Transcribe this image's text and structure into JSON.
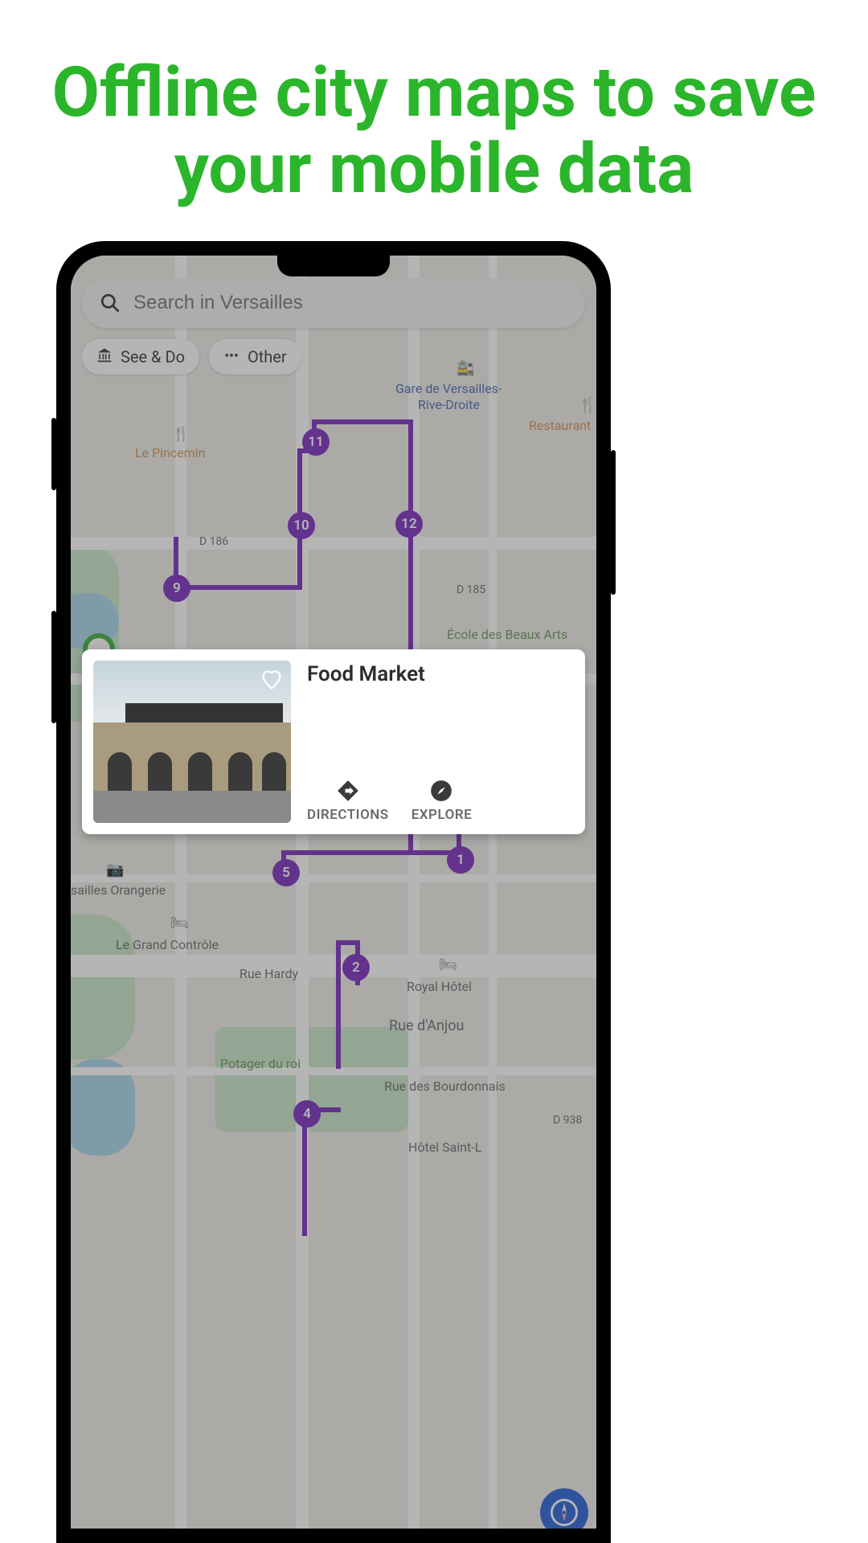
{
  "headline": "Offline city maps to save your mobile data",
  "search": {
    "placeholder": "Search in Versailles"
  },
  "chips": {
    "see_do": "See & Do",
    "other": "Other"
  },
  "map": {
    "labels": {
      "gare_l1": "Gare de Versailles-",
      "gare_l2": "Rive-Droite",
      "restaurant": "Restaurant",
      "le_pincemin": "Le Pincemin",
      "d186": "D 186",
      "d185": "D 185",
      "ecole": "École des Beaux Arts",
      "orangerie": "sailles Orangerie",
      "grand_controle": "Le Grand Contrôle",
      "rue_hardy": "Rue Hardy",
      "royal_hotel": "Royal Hôtel",
      "rue_anjou": "Rue d'Anjou",
      "potager": "Potager du roi",
      "rue_bourdonnais": "Rue des Bourdonnais",
      "hotel_saint": "Hôtel Saint-L",
      "d938": "D 938"
    },
    "waypoints": {
      "w1": "1",
      "w2": "2",
      "w4": "4",
      "w5": "5",
      "w9": "9",
      "w10": "10",
      "w11": "11",
      "w12": "12"
    }
  },
  "card": {
    "title": "Food Market",
    "directions": "DIRECTIONS",
    "explore": "EXPLORE"
  }
}
